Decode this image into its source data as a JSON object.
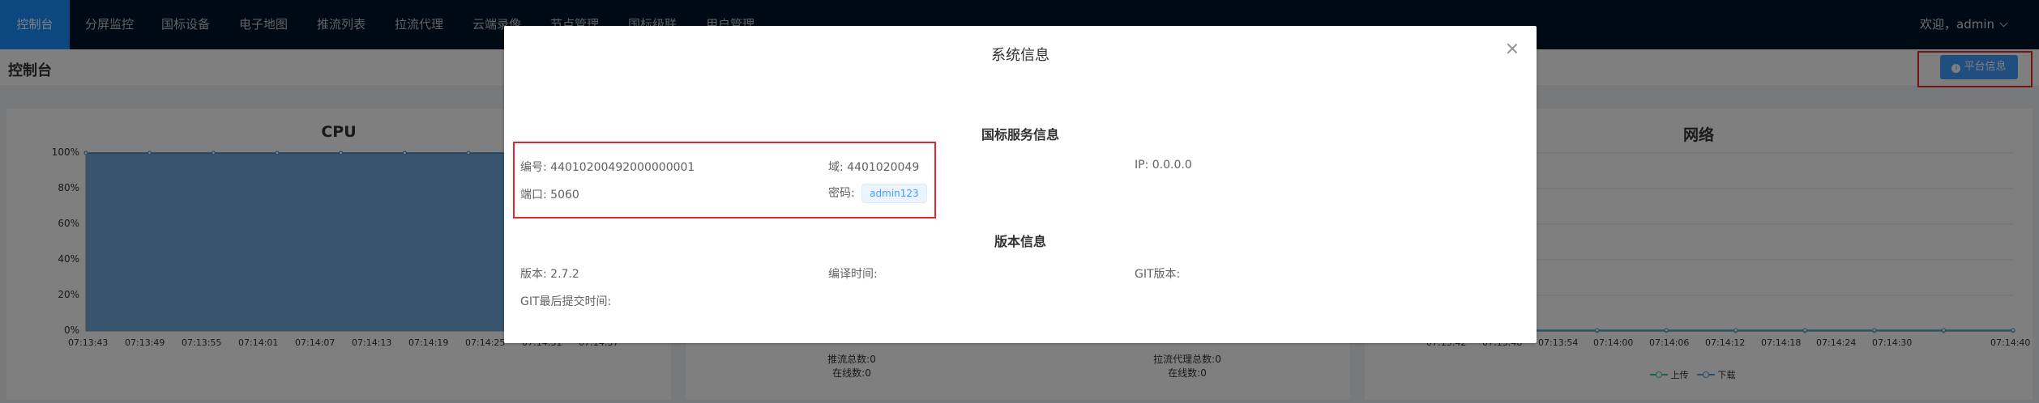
{
  "nav": {
    "items": [
      "控制台",
      "分屏监控",
      "国标设备",
      "电子地图",
      "推流列表",
      "拉流代理",
      "云端录像",
      "节点管理",
      "国标级联",
      "用户管理"
    ],
    "user": "欢迎，admin"
  },
  "subheader": {
    "title": "控制台",
    "platform_button": "平台信息"
  },
  "cpu": {
    "title": "CPU",
    "y_ticks": [
      "100%",
      "80%",
      "60%",
      "40%",
      "20%",
      "0%"
    ],
    "x_ticks": [
      "07:13:43",
      "07:13:49",
      "07:13:55",
      "07:14:01",
      "07:14:07",
      "07:14:13",
      "07:14:19",
      "07:14:25",
      "07:14:31",
      "07:14:37"
    ]
  },
  "chart_data": [
    {
      "type": "area",
      "title": "CPU",
      "x": [
        "07:13:43",
        "07:13:49",
        "07:13:55",
        "07:14:01",
        "07:14:07",
        "07:14:13",
        "07:14:19",
        "07:14:25",
        "07:14:31",
        "07:14:37"
      ],
      "values": [
        100,
        100,
        100,
        100,
        100,
        100,
        100,
        100,
        100,
        100
      ],
      "ylim": [
        0,
        100
      ],
      "color": "#5b9bd5"
    },
    {
      "type": "line",
      "title": "网络",
      "x": [
        "07:13:42",
        "07:13:48",
        "07:13:54",
        "07:14:00",
        "07:14:06",
        "07:14:12",
        "07:14:18",
        "07:14:24",
        "07:14:30",
        "07:14:40"
      ],
      "series": [
        {
          "name": "上传",
          "values": [
            0,
            0,
            0,
            0,
            0,
            0,
            0,
            0,
            0,
            0
          ]
        },
        {
          "name": "下载",
          "values": [
            0,
            0,
            0,
            0,
            0,
            0,
            0,
            0,
            0,
            0
          ]
        }
      ]
    }
  ],
  "stats": {
    "push": {
      "total": "推流总数:0",
      "online": "在线数:0"
    },
    "proxy": {
      "total": "拉流代理总数:0",
      "online": "在线数:0"
    }
  },
  "network": {
    "title": "网络",
    "x_ticks": [
      "07:13:42",
      "07:13:48",
      "07:13:54",
      "07:14:00",
      "07:14:06",
      "07:14:12",
      "07:14:18",
      "07:14:24",
      "07:14:30",
      "07:14:40"
    ],
    "legend": [
      "上传",
      "下载"
    ]
  },
  "dialog": {
    "title": "系统信息",
    "gb_section": "国标服务信息",
    "id_label": "编号:",
    "id_value": "44010200492000000001",
    "domain_label": "域:",
    "domain_value": "4401020049",
    "ip_label": "IP:",
    "ip_value": "0.0.0.0",
    "port_label": "端口:",
    "port_value": "5060",
    "pwd_label": "密码:",
    "pwd_value": "admin123",
    "ver_section": "版本信息",
    "version_label": "版本:",
    "version_value": "2.7.2",
    "compile_label": "编译时间:",
    "git_label": "GIT版本:",
    "git_commit_label": "GIT最后提交时间:"
  },
  "colors": {
    "highlight": "#e5262a",
    "accent": "#1890ff",
    "nav_bg": "#001529"
  }
}
